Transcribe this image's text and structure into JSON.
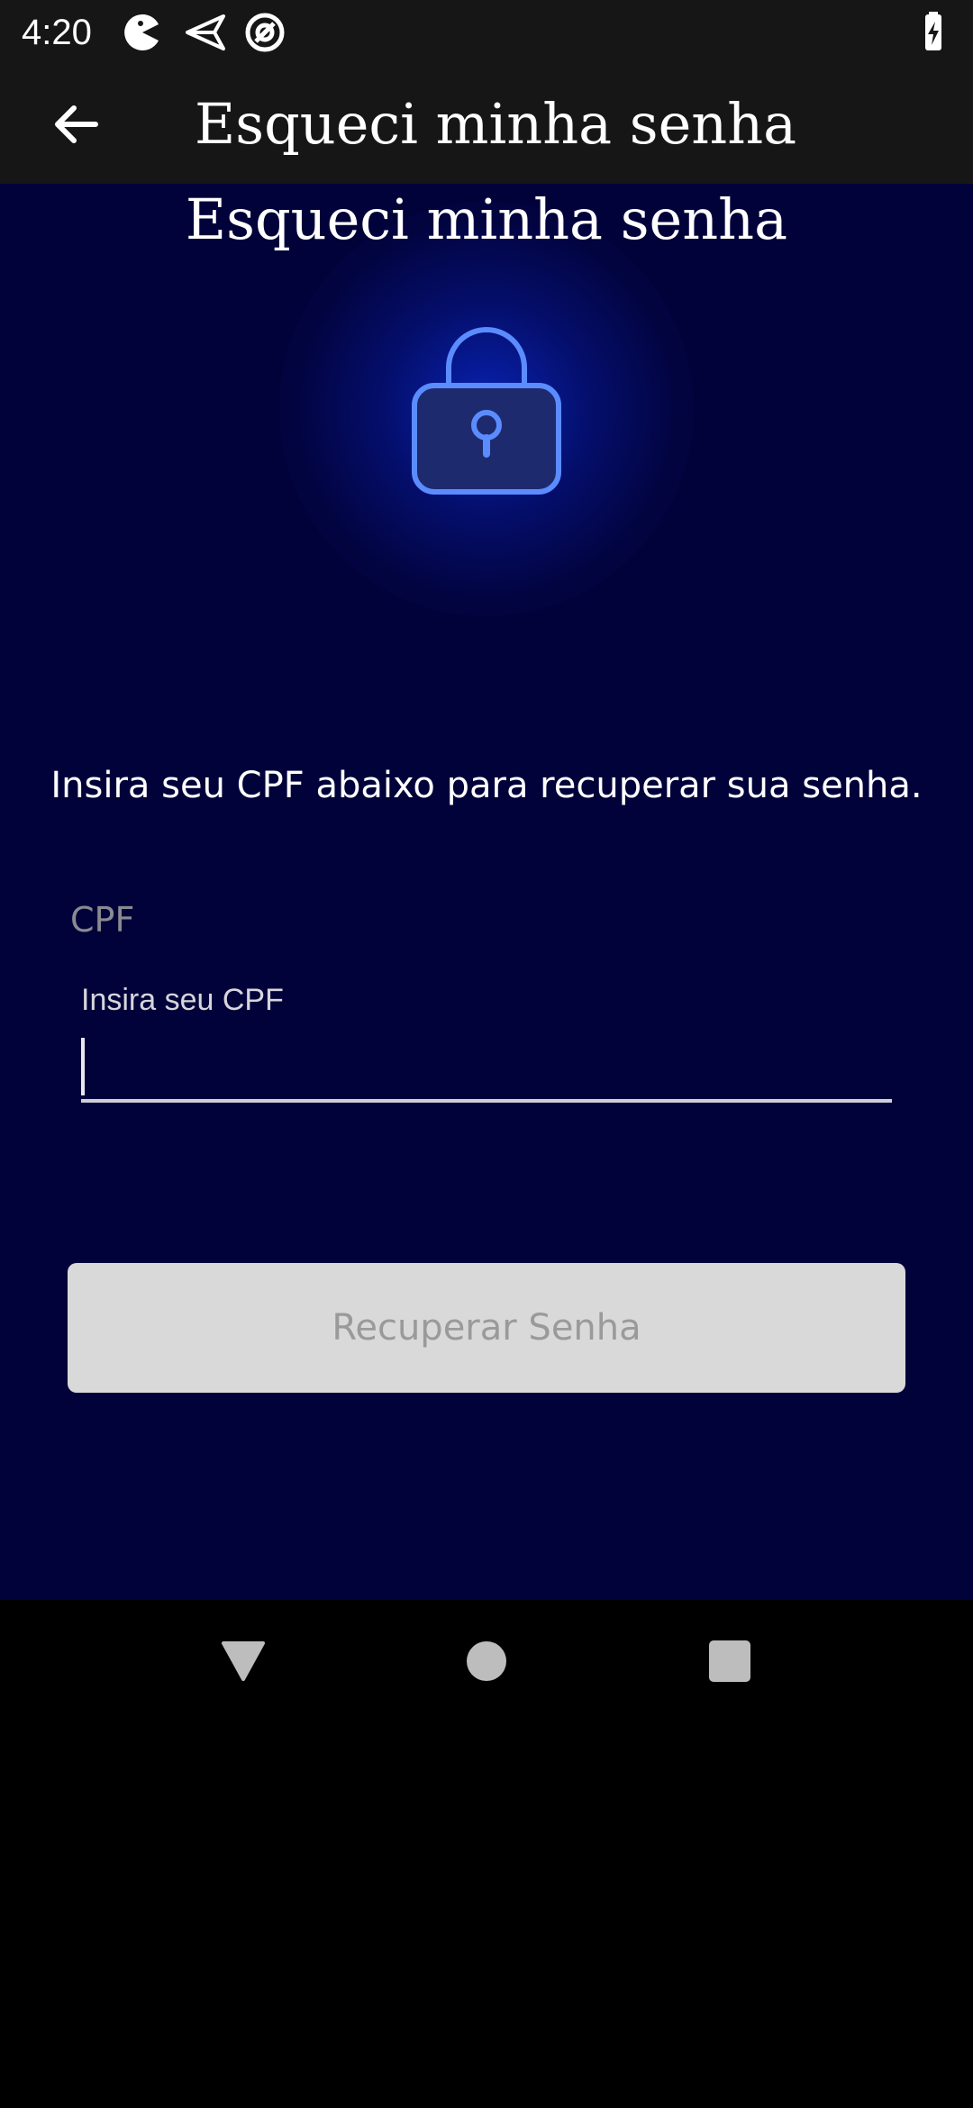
{
  "status_bar": {
    "time": "4:20",
    "icons": [
      "pacman-icon",
      "send-icon",
      "at-sign-icon",
      "battery-charging-icon"
    ]
  },
  "app_bar": {
    "back_icon": "arrow-left-icon",
    "title": "Esqueci minha senha"
  },
  "main": {
    "icon": "lock-icon",
    "heading": "Esqueci minha senha",
    "subtitle": "Insira seu CPF abaixo para recuperar sua senha.",
    "cpf_field": {
      "label": "CPF",
      "hint": "Insira seu CPF",
      "value": ""
    },
    "submit_label": "Recuperar Senha"
  },
  "nav_bar": {
    "icons": [
      "back-triangle-icon",
      "home-circle-icon",
      "recents-square-icon"
    ]
  },
  "colors": {
    "status_bar_bg": "#161616",
    "content_bg": "#02023a",
    "glow": "#0a28c8",
    "lock_stroke": "#5b8cff",
    "button_bg": "#d9d9d9",
    "button_text": "#9a9a9a"
  }
}
